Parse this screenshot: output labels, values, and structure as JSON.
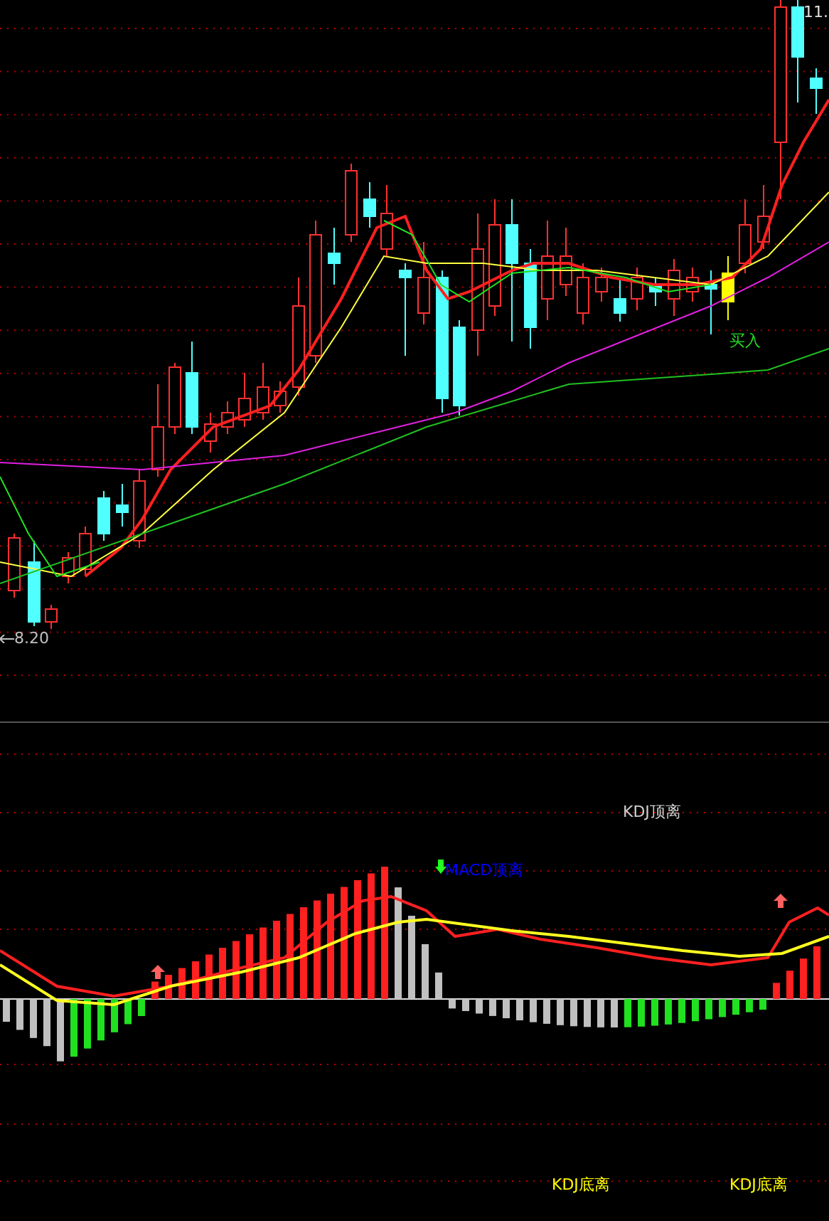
{
  "main_chart": {
    "price_high_label": "11.",
    "price_low_label": "8.20",
    "signal_label": "买入"
  },
  "indicator_chart": {
    "signals": [
      {
        "kind": "kdj_top",
        "text": "KDJ顶离",
        "color": "#d0d0d0"
      },
      {
        "kind": "macd_top",
        "text": "MACD顶离",
        "color": "#0000ff"
      },
      {
        "kind": "kdj_bottom",
        "text": "KDJ底离",
        "color": "#ffff00"
      },
      {
        "kind": "kdj_bottom",
        "text": "KDJ底离",
        "color": "#ffff00"
      }
    ]
  }
}
